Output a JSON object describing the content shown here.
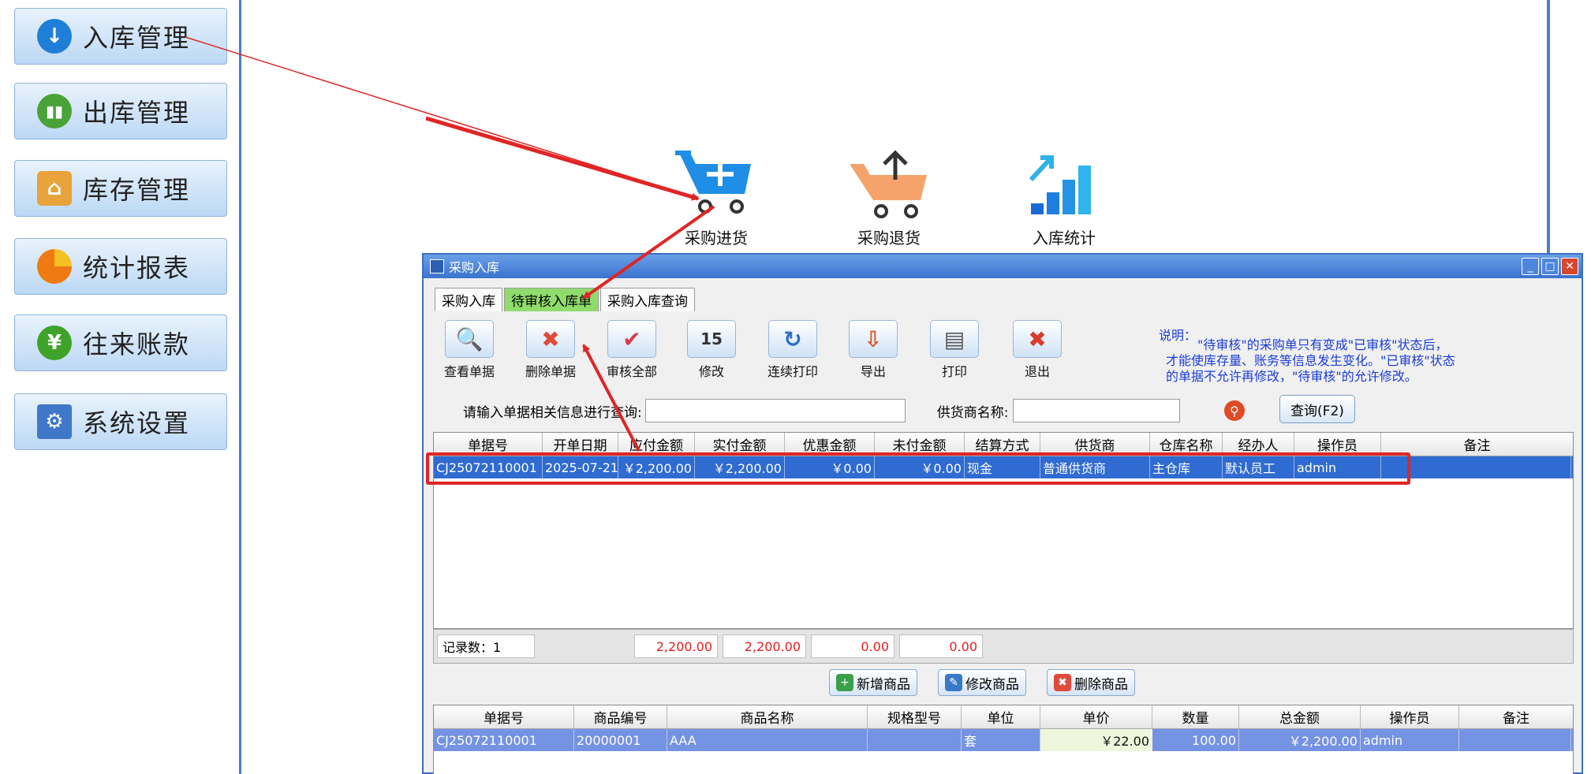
{
  "sidebar": {
    "items": [
      {
        "label": "入库管理",
        "icon": "down-arrow-icon",
        "color": "#1f7fd8"
      },
      {
        "label": "出库管理",
        "icon": "bar-chart-icon",
        "color": "#4aa336"
      },
      {
        "label": "库存管理",
        "icon": "house-icon",
        "color": "#e8a33a"
      },
      {
        "label": "统计报表",
        "icon": "pie-chart-icon",
        "color": "#f08a1c"
      },
      {
        "label": "往来账款",
        "icon": "yen-icon",
        "color": "#3fa32a"
      },
      {
        "label": "系统设置",
        "icon": "gear-icon",
        "color": "#3f78c8"
      }
    ]
  },
  "quick_actions": [
    {
      "label": "采购进货",
      "icon": "cart-plus-icon"
    },
    {
      "label": "采购退货",
      "icon": "cart-return-icon"
    },
    {
      "label": "入库统计",
      "icon": "stats-arrow-icon"
    }
  ],
  "window": {
    "title": "采购入库",
    "controls": {
      "minimize": "_",
      "maximize": "□",
      "close": "✕"
    },
    "tabs": [
      {
        "label": "采购入库",
        "active": false
      },
      {
        "label": "待审核入库单",
        "active": true
      },
      {
        "label": "采购入库查询",
        "active": false
      }
    ],
    "toolbar": [
      {
        "label": "查看单据",
        "icon": "magnifier-icon",
        "glyph": "🔍",
        "color": "#2c6fc6"
      },
      {
        "label": "删除单据",
        "icon": "delete-x-icon",
        "glyph": "✖",
        "color": "#e04a3a"
      },
      {
        "label": "审核全部",
        "icon": "check-icon",
        "glyph": "✔",
        "color": "#d93a4a"
      },
      {
        "label": "修改",
        "icon": "calendar-edit-icon",
        "glyph": "15",
        "color": "#333333"
      },
      {
        "label": "连续打印",
        "icon": "scroll-print-icon",
        "glyph": "↻",
        "color": "#2c6fc6"
      },
      {
        "label": "导出",
        "icon": "export-icon",
        "glyph": "⇩",
        "color": "#d85a2a"
      },
      {
        "label": "打印",
        "icon": "printer-icon",
        "glyph": "▤",
        "color": "#555555"
      },
      {
        "label": "退出",
        "icon": "exit-icon",
        "glyph": "✖",
        "color": "#d93a2a"
      }
    ],
    "note": {
      "title": "说明：",
      "lines": [
        "\"待审核\"的采购单只有变成\"已审核\"状态后，",
        "才能使库存量、账务等信息发生变化。\"已审核\"状态",
        "的单据不允许再修改，\"待审核\"的允许修改。"
      ]
    },
    "search": {
      "label": "请输入单据相关信息进行查询:",
      "value": "",
      "supplier_label": "供货商名称:",
      "supplier_value": "",
      "query_button": "查询(F2)"
    },
    "orders_table": {
      "columns": [
        "单据号",
        "开单日期",
        "应付金额",
        "实付金额",
        "优惠金额",
        "未付金额",
        "结算方式",
        "供货商",
        "仓库名称",
        "经办人",
        "操作员",
        "备注"
      ],
      "rows": [
        [
          "CJ25072110001",
          "2025-07-21",
          "￥2,200.00",
          "￥2,200.00",
          "￥0.00",
          "￥0.00",
          "现金",
          "普通供货商",
          "主仓库",
          "默认员工",
          "admin",
          ""
        ]
      ]
    },
    "footer": {
      "record_label": "记录数：1",
      "totals": [
        "2,200.00",
        "2,200.00",
        "0.00",
        "0.00"
      ]
    },
    "item_buttons": [
      {
        "label": "新增商品",
        "icon": "add-item-icon"
      },
      {
        "label": "修改商品",
        "icon": "edit-item-icon"
      },
      {
        "label": "删除商品",
        "icon": "delete-item-icon"
      }
    ],
    "items_table": {
      "columns": [
        "单据号",
        "商品编号",
        "商品名称",
        "规格型号",
        "单位",
        "单价",
        "数量",
        "总金额",
        "操作员",
        "备注"
      ],
      "rows": [
        [
          "CJ25072110001",
          "20000001",
          "AAA",
          "",
          "套",
          "￥22.00",
          "100.00",
          "￥2,200.00",
          "admin",
          ""
        ]
      ]
    }
  },
  "colors": {
    "annotation_red": "#e02525",
    "selected_row": "#2f6bd1",
    "active_tab": "#8fdc6d"
  }
}
